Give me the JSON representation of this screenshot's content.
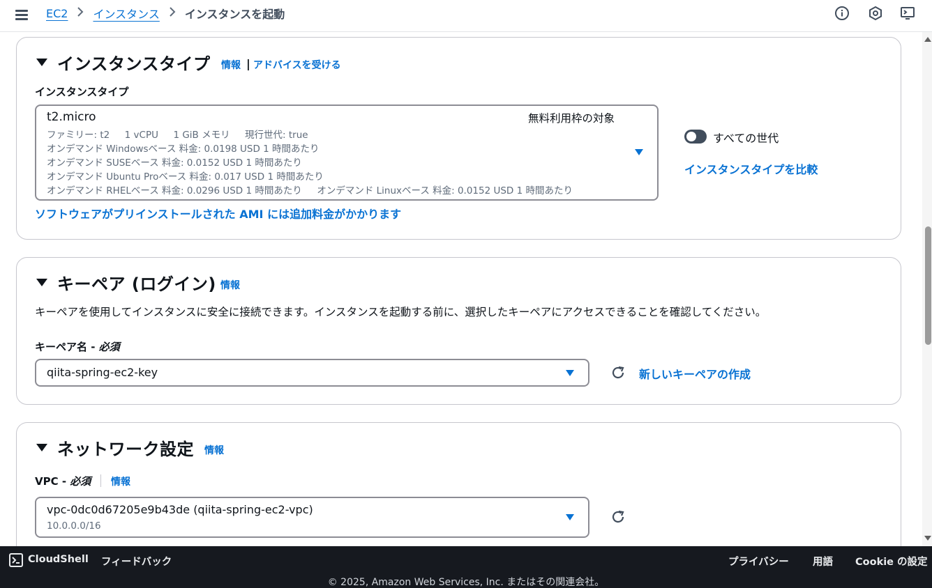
{
  "breadcrumb": {
    "items": [
      "EC2",
      "インスタンス"
    ],
    "current": "インスタンスを起動"
  },
  "instance_type_section": {
    "title": "インスタンスタイプ",
    "info_link": "情報",
    "separator": "|",
    "advice_link": "アドバイスを受ける",
    "field_label": "インスタンスタイプ",
    "selected": {
      "name": "t2.micro",
      "badge": "無料利用枠の対象",
      "line1": "ファミリー: t2     1 vCPU     1 GiB メモリ     現行世代: true",
      "line2": "オンデマンド Windowsベース 料金: 0.0198 USD 1 時間あたり",
      "line3": "オンデマンド SUSEベース 料金: 0.0152 USD 1 時間あたり",
      "line4": "オンデマンド Ubuntu Proベース 料金: 0.017 USD 1 時間あたり",
      "line5": "オンデマンド RHELベース 料金: 0.0296 USD 1 時間あたり     オンデマンド Linuxベース 料金: 0.0152 USD 1 時間あたり"
    },
    "toggle_label": "すべての世代",
    "toggle_on": false,
    "compare_link": "インスタンスタイプを比較",
    "ami_notice_link": "ソフトウェアがプリインストールされた AMI には追加料金がかかります"
  },
  "keypair_section": {
    "title": "キーペア (ログイン)",
    "info_link": "情報",
    "description": "キーペアを使用してインスタンスに安全に接続できます。インスタンスを起動する前に、選択したキーペアにアクセスできることを確認してください。",
    "field_label": "キーペア名 - ",
    "required": "必須",
    "selected": "qiita-spring-ec2-key",
    "create_link": "新しいキーペアの作成"
  },
  "network_section": {
    "title": "ネットワーク設定",
    "info_link": "情報",
    "vpc_label": "VPC - ",
    "vpc_required": "必須",
    "vpc_info_link": "情報",
    "vpc_selected": "vpc-0dc0d67205e9b43de (qiita-spring-ec2-vpc)",
    "vpc_cidr": "10.0.0.0/16"
  },
  "footer": {
    "cloudshell": "CloudShell",
    "feedback": "フィードバック",
    "privacy": "プライバシー",
    "terms": "用語",
    "cookie": "Cookie の設定",
    "copyright": "© 2025, Amazon Web Services, Inc. またはその関連会社。"
  },
  "colors": {
    "link": "#0972d3",
    "footer_bg": "#16191f",
    "text": "#0f141a"
  },
  "icons": [
    "menu-icon",
    "chevron-right-icon",
    "info-icon",
    "notifications-icon",
    "settings-icon",
    "refresh-icon",
    "cloudshell-icon",
    "caret-down-icon"
  ]
}
